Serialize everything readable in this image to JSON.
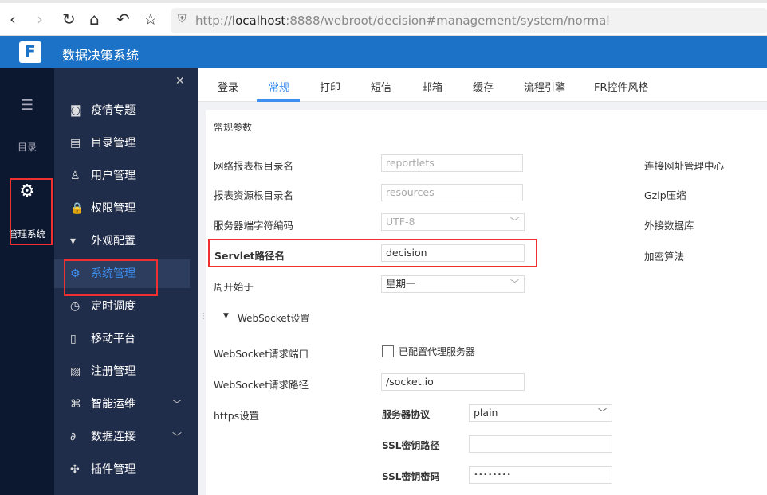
{
  "browser": {
    "url_prefix": "http://",
    "url_host": "localhost",
    "url_rest": ":8888/webroot/decision#management/system/normal"
  },
  "header": {
    "logo": "F",
    "title": "数据决策系统"
  },
  "rail": [
    {
      "label": "目录",
      "icon": "list-icon"
    },
    {
      "label": "管理系统",
      "icon": "gear-icon"
    }
  ],
  "sidebar": {
    "items": [
      {
        "label": "疫情专题",
        "icon": "◙"
      },
      {
        "label": "目录管理",
        "icon": "▤"
      },
      {
        "label": "用户管理",
        "icon": "♙"
      },
      {
        "label": "权限管理",
        "icon": "🔒"
      },
      {
        "label": "外观配置",
        "icon": "▾"
      },
      {
        "label": "系统管理",
        "icon": "⚙"
      },
      {
        "label": "定时调度",
        "icon": "◷"
      },
      {
        "label": "移动平台",
        "icon": "▯"
      },
      {
        "label": "注册管理",
        "icon": "▨"
      },
      {
        "label": "智能运维",
        "icon": "⌘",
        "chev": "﹀"
      },
      {
        "label": "数据连接",
        "icon": "∂",
        "chev": "﹀"
      },
      {
        "label": "插件管理",
        "icon": "✣"
      }
    ]
  },
  "tabs": [
    "登录",
    "常规",
    "打印",
    "短信",
    "邮箱",
    "缓存",
    "流程引擎",
    "FR控件风格"
  ],
  "section": "常规参数",
  "fields": {
    "report_root": {
      "label": "网络报表根目录名",
      "value": "reportlets"
    },
    "res_root": {
      "label": "报表资源根目录名",
      "value": "resources"
    },
    "encoding": {
      "label": "服务器端字符编码",
      "value": "UTF-8"
    },
    "servlet": {
      "label": "Servlet路径名",
      "value": "decision"
    },
    "week": {
      "label": "周开始于",
      "value": "星期一"
    },
    "ws_section": "WebSocket设置",
    "ws_port": {
      "label": "WebSocket请求端口",
      "checkbox": "已配置代理服务器"
    },
    "ws_path": {
      "label": "WebSocket请求路径",
      "value": "/socket.io"
    },
    "https": {
      "label": "https设置",
      "protocol_label": "服务器协议",
      "protocol": "plain",
      "ssl_path_label": "SSL密钥路径",
      "ssl_pwd_label": "SSL密钥密码",
      "ssl_pwd": "••••••••"
    }
  },
  "right": [
    "连接网址管理中心",
    "Gzip压缩",
    "外接数据库",
    "加密算法"
  ]
}
